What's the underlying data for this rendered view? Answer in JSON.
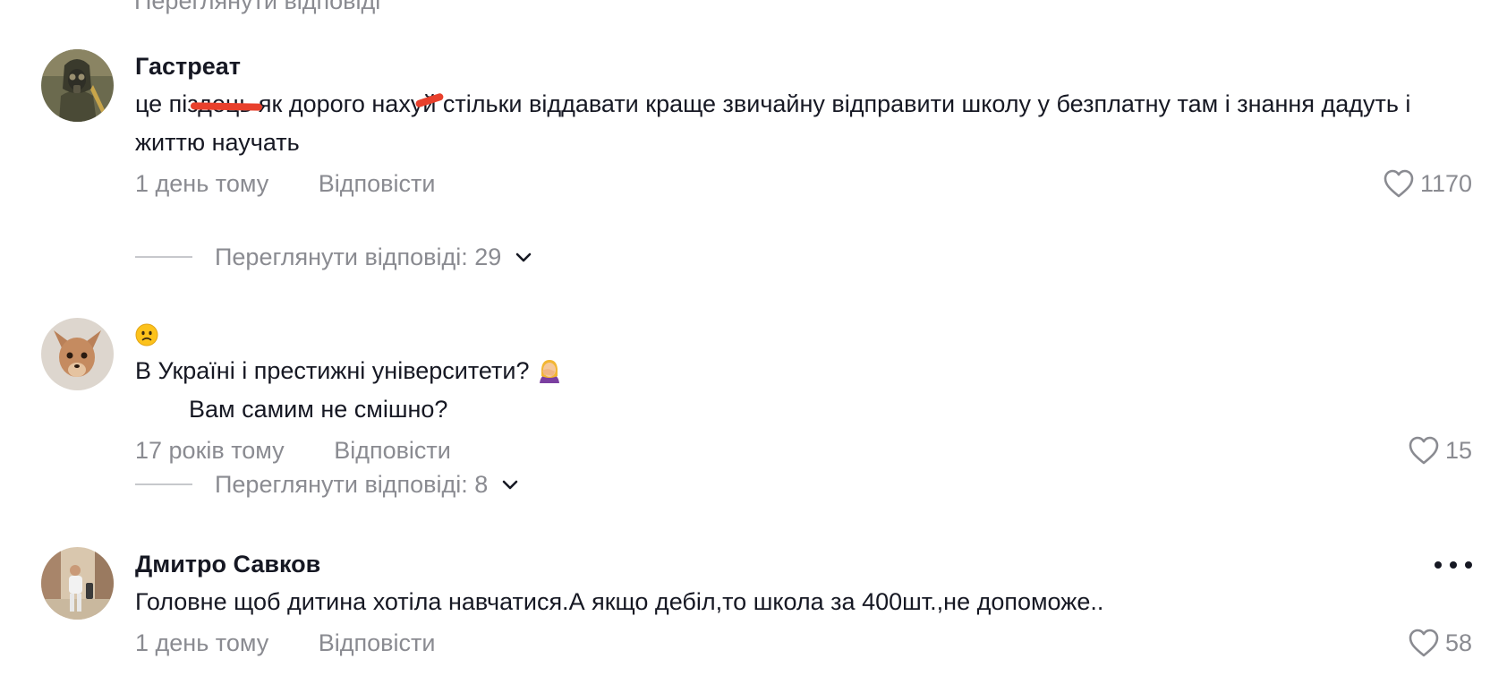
{
  "top_cut_text": "Переглянути відповіді",
  "comments": [
    {
      "author": "Гастреат",
      "text": "це піздець як дорого нахуй стільки віддавати краще звичайну відправити школу у безплатну там і знання дадуть і життю научать",
      "time": "1 день тому",
      "reply": "Відповісти",
      "likes": "1170",
      "view_replies": "Переглянути відповіді: 29"
    },
    {
      "author": "🙁",
      "text_before": "В Україні і престижні університети? ",
      "text_emoji": "🤦‍♀️",
      "text_after": "Вам самим не смішно?",
      "time": "17 років тому",
      "reply": "Відповісти",
      "likes": "15",
      "view_replies": "Переглянути відповіді: 8"
    },
    {
      "author": "Дмитро Савков",
      "text": "Головне щоб дитина хотіла навчатися.А якщо дебіл,то школа за 400шт.,не допоможе..",
      "time": "1 день тому",
      "reply": "Відповісти",
      "likes": "58"
    }
  ],
  "icons": {
    "like": "heart-outline-icon",
    "expand": "chevron-down-icon",
    "menu": "more-horizontal-icon"
  },
  "colors": {
    "text_primary": "#161823",
    "text_secondary": "#8a8b91",
    "censor_marks": "#e8402c"
  }
}
